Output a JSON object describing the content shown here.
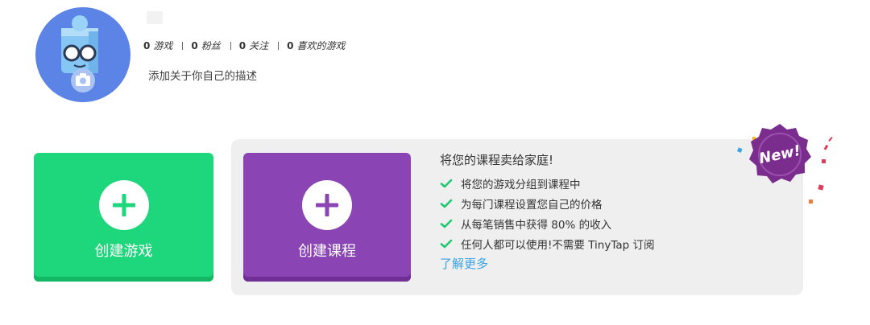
{
  "profile": {
    "stats": [
      {
        "count": "0",
        "label": "游戏"
      },
      {
        "count": "0",
        "label": "粉丝"
      },
      {
        "count": "0",
        "label": "关注"
      },
      {
        "count": "0",
        "label": "喜欢的游戏"
      }
    ],
    "description_prompt": "添加关于你自己的描述"
  },
  "create_game": {
    "label": "创建游戏",
    "color": "#1ed67b"
  },
  "create_course": {
    "label": "创建课程",
    "color": "#8b44b3"
  },
  "course_promo": {
    "title": "将您的课程卖给家庭!",
    "features": [
      "将您的游戏分组到课程中",
      "为每门课程设置您自己的价格",
      "从每笔销售中获得 80% 的收入",
      "任何人都可以使用!不需要 TinyTap 订阅"
    ],
    "learn_more": "了解更多",
    "check_color": "#1ec96f",
    "link_color": "#3aa3e3"
  },
  "new_badge": {
    "text": "New!",
    "color": "#7b2d8e"
  }
}
